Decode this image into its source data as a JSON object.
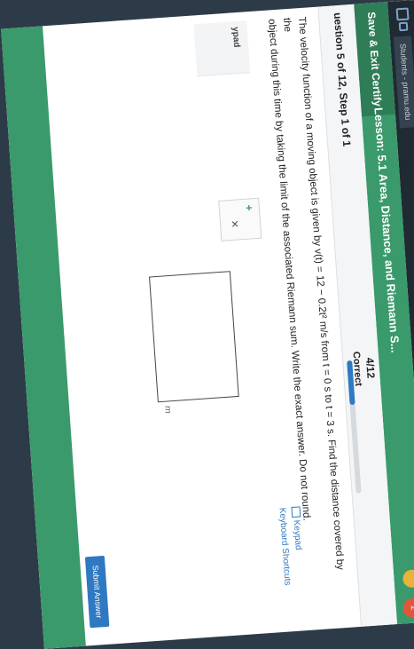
{
  "browser": {
    "tab_title": "Students - pramu.edu"
  },
  "header": {
    "save_exit": "Save & Exit Certify",
    "lesson": "Lesson: 5.1 Area, Distance, and Riemann S...",
    "notification_count": "2"
  },
  "progress": {
    "question_label": "uestion 5 of 12, Step 1 of 1",
    "score": "4/12",
    "status": "Correct",
    "fraction": 0.3333
  },
  "question": {
    "text_a": "The velocity function of a moving object is given by v(t) = 12 − 0.2t² m/s from t = 0 s to t = 3 s. Find the distance covered by the",
    "text_b": "object during this time by taking the limit of the associated Riemann sum. Write the exact answer. Do not round."
  },
  "tools": {
    "keypad_label": "Keypad",
    "shortcuts_label": "Keyboard Shortcuts",
    "keypad_side_label": "ypad",
    "answer_unit": "m"
  },
  "actions": {
    "submit_label": "Submit Answer"
  },
  "colors": {
    "header_green": "#3a9a6b",
    "progress_blue": "#2f79c2"
  }
}
